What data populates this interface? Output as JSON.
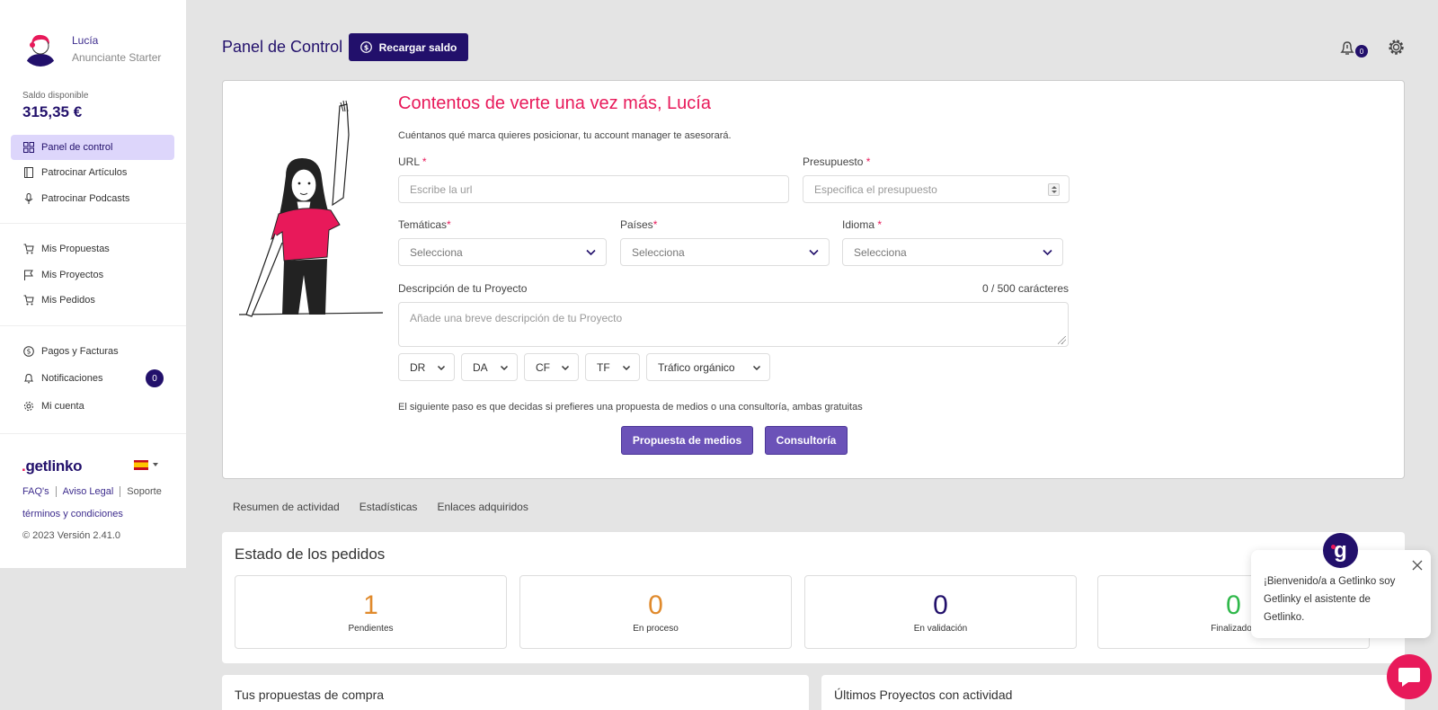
{
  "sidebar": {
    "user_name": "Lucía",
    "user_plan": "Anunciante Starter",
    "balance_label": "Saldo disponible",
    "balance_amount": "315,35 €",
    "items": [
      {
        "label": "Panel de control"
      },
      {
        "label": "Patrocinar Artículos"
      },
      {
        "label": "Patrocinar Podcasts"
      },
      {
        "label": "Mis Propuestas"
      },
      {
        "label": "Mis Proyectos"
      },
      {
        "label": "Mis Pedidos"
      },
      {
        "label": "Pagos y Facturas"
      },
      {
        "label": "Notificaciones",
        "badge": "0"
      },
      {
        "label": "Mi cuenta"
      }
    ],
    "logo_dot": ".",
    "logo_text": "getlinko",
    "footer_links": [
      "FAQ's",
      "Aviso Legal",
      "Soporte"
    ],
    "terms": "términos y condiciones",
    "version": "© 2023 Versión 2.41.0"
  },
  "header": {
    "title": "Panel de Control",
    "recharge_label": "Recargar saldo",
    "notif_count": "0"
  },
  "form": {
    "welcome": "Contentos de verte una vez más, Lucía",
    "subtitle": "Cuéntanos qué marca quieres posicionar, tu account manager te asesorará.",
    "url_label": "URL",
    "url_placeholder": "Escribe la url",
    "budget_label": "Presupuesto",
    "budget_placeholder": "Especifica el presupuesto",
    "topics_label": "Temáticas",
    "countries_label": "Países",
    "language_label": "Idioma",
    "select_placeholder": "Selecciona",
    "required_mark": "*",
    "description_label": "Descripción de tu Proyecto",
    "description_counter": "0 / 500 carácteres",
    "description_placeholder": "Añade una breve descripción de tu Proyecto",
    "filters": [
      "DR",
      "DA",
      "CF",
      "TF",
      "Tráfico orgánico"
    ],
    "next_step": "El siguiente paso es que decidas si prefieres una propuesta de medios o una consultoría, ambas gratuitas",
    "media_button": "Propuesta de medios",
    "consult_button": "Consultoría"
  },
  "tabs": [
    "Resumen de actividad",
    "Estadísticas",
    "Enlaces adquiridos"
  ],
  "orders": {
    "title": "Estado de los pedidos",
    "stats": [
      {
        "value": "1",
        "label": "Pendientes",
        "color": "#e08a2c"
      },
      {
        "value": "0",
        "label": "En proceso",
        "color": "#e08a2c"
      },
      {
        "value": "0",
        "label": "En validación",
        "color": "#22106b"
      },
      {
        "value": "0",
        "label": "Finalizados",
        "color": "#2fb84a"
      }
    ]
  },
  "panels": {
    "proposals_title": "Tus propuestas de compra",
    "projects_title": "Últimos Proyectos con actividad"
  },
  "chat": {
    "logo_letter": "g",
    "message": "¡Bienvenido/a a Getlinko soy Getlinky el asistente de Getlinko."
  },
  "colors": {
    "brand_dark": "#22106b",
    "accent_pink": "#e8195a",
    "button_purple": "#6b52b8"
  }
}
